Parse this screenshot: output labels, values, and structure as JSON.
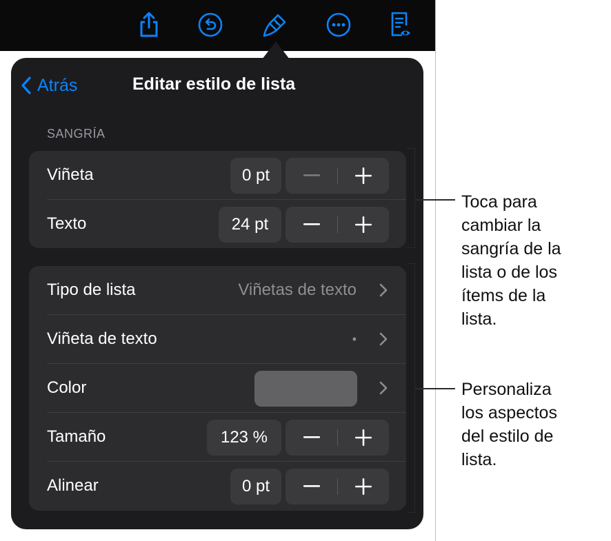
{
  "toolbar": {
    "icons": [
      "share-icon",
      "undo-icon",
      "format-brush-icon",
      "more-icon",
      "reader-view-icon"
    ]
  },
  "nav": {
    "back_label": "Atrás",
    "title": "Editar estilo de lista"
  },
  "indent_section": {
    "header": "SANGRÍA",
    "rows": [
      {
        "label": "Viñeta",
        "value": "0 pt",
        "minus": "−",
        "plus": "+"
      },
      {
        "label": "Texto",
        "value": "24 pt",
        "minus": "−",
        "plus": "+"
      }
    ]
  },
  "style_section": {
    "list_type": {
      "label": "Tipo de lista",
      "value": "Viñetas de texto"
    },
    "text_bullet": {
      "label": "Viñeta de texto",
      "value": "•"
    },
    "color": {
      "label": "Color",
      "swatch": "#626265"
    },
    "size": {
      "label": "Tamaño",
      "value": "123 %",
      "minus": "−",
      "plus": "+"
    },
    "align": {
      "label": "Alinear",
      "value": "0 pt",
      "minus": "−",
      "plus": "+"
    }
  },
  "callouts": {
    "indent": [
      "Toca para",
      "cambiar la",
      "sangría de la",
      "lista o de los",
      "ítems de la",
      "lista."
    ],
    "style": [
      "Personaliza",
      "los aspectos",
      "del estilo de",
      "lista."
    ]
  },
  "colors": {
    "accent": "#0a84ff",
    "popover_bg": "#1c1c1e",
    "group_bg": "#2c2c2e",
    "control_bg": "#3a3a3c"
  }
}
